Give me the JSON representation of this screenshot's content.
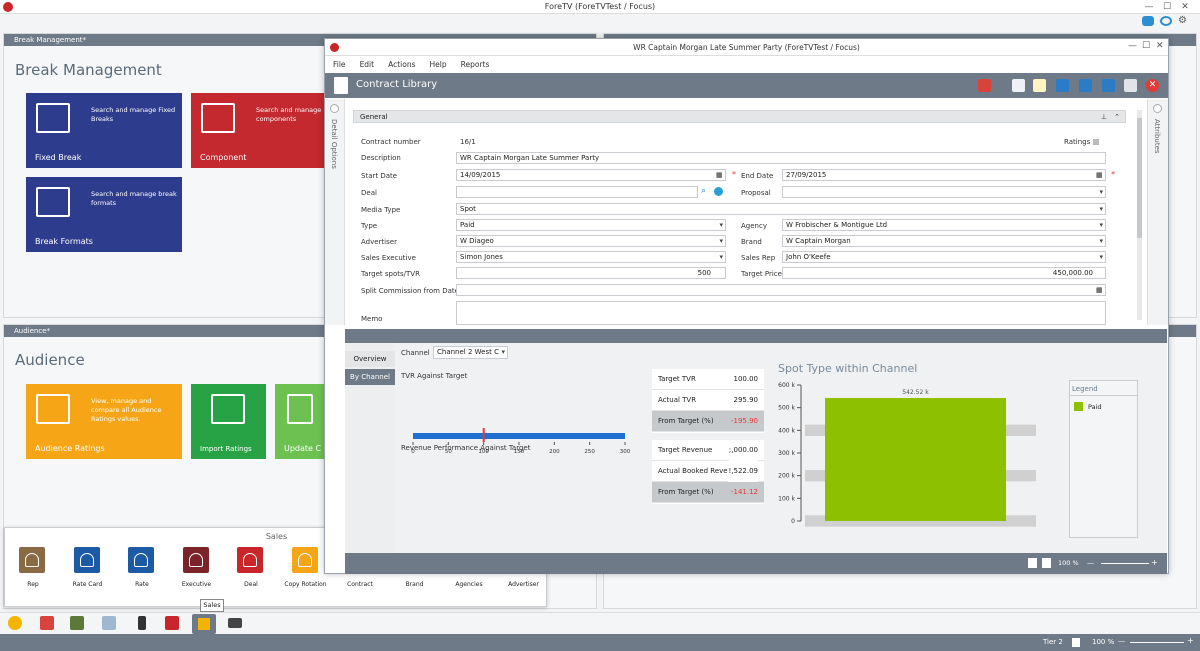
{
  "app": {
    "title": "ForeTV (ForeTVTest / Focus)"
  },
  "break_panel": {
    "header": "Break Management*",
    "title": "Break Management",
    "tiles": [
      {
        "name": "Fixed Break",
        "desc": "Search and manage Fixed Breaks",
        "color": "#2e3c8d"
      },
      {
        "name": "Component",
        "desc": "Search and manage components",
        "color": "#c3292f"
      },
      {
        "name": "Break Formats",
        "desc": "Search and manage break formats",
        "color": "#2e3c8d"
      }
    ]
  },
  "audience_panel": {
    "header": "Audience*",
    "title": "Audience",
    "tiles": [
      {
        "name": "Audience Ratings",
        "desc": "View, manage and compare all Audience Ratings values.",
        "color": "#f5a515"
      },
      {
        "name": "Import Ratings",
        "color": "#27a345"
      },
      {
        "name": "Update C",
        "color": "#6cc150"
      }
    ]
  },
  "sales_panel": {
    "title": "Sales",
    "tooltip": "Sales",
    "items": [
      {
        "label": "Rep",
        "color": "#8a6a45"
      },
      {
        "label": "Rate Card",
        "color": "#1d5aa5"
      },
      {
        "label": "Rate",
        "color": "#1d5aa5"
      },
      {
        "label": "Executive",
        "color": "#7a2328"
      },
      {
        "label": "Deal",
        "color": "#c8262b"
      },
      {
        "label": "Copy Rotation",
        "color": "#f5a515"
      },
      {
        "label": "Contract",
        "color": "#4caf50"
      },
      {
        "label": "Brand",
        "color": "#ef7d1a"
      },
      {
        "label": "Agencies",
        "color": "#5a5a5a"
      },
      {
        "label": "Advertiser",
        "color": "#5b3a8f"
      }
    ]
  },
  "contract_window": {
    "title": "WR Captain Morgan Late Summer Party (ForeTVTest / Focus)",
    "menu": [
      "File",
      "Edit",
      "Actions",
      "Help",
      "Reports"
    ],
    "header": "Contract Library",
    "left_tab": "Detail Options",
    "right_tab": "Attributes",
    "section": "General",
    "ratings_label": "Ratings",
    "form": {
      "contract_number_label": "Contract number",
      "contract_number": "16/1",
      "description_label": "Description",
      "description": "WR Captain Morgan Late Summer Party",
      "start_date_label": "Start Date",
      "start_date": "14/09/2015",
      "end_date_label": "End Date",
      "end_date": "27/09/2015",
      "deal_label": "Deal",
      "deal": "",
      "proposal_label": "Proposal",
      "proposal": "",
      "media_type_label": "Media Type",
      "media_type": "Spot",
      "type_label": "Type",
      "type": "Paid",
      "agency_label": "Agency",
      "agency": "W Frobischer & Montigue Ltd",
      "advertiser_label": "Advertiser",
      "advertiser": "W Diageo",
      "brand_label": "Brand",
      "brand": "W Captain Morgan",
      "sales_exec_label": "Sales Executive",
      "sales_exec": "Simon Jones",
      "sales_rep_label": "Sales Rep",
      "sales_rep": "John O'Keefe",
      "target_spots_label": "Target spots/TVR",
      "target_spots": "500",
      "target_price_label": "Target Price",
      "target_price": "450,000.00",
      "split_label": "Split Commission from Date",
      "split": "",
      "memo_label": "Memo"
    },
    "overview": {
      "tabs": [
        "Overview",
        "By Channel"
      ],
      "channel_label": "Channel",
      "channel": "Channel 2 West C",
      "tvr_title": "TVR Against Target",
      "tvr_ticks": [
        "0",
        "50",
        "100",
        "150",
        "200",
        "250",
        "300"
      ],
      "tvr_fill": 1.0,
      "tvr_marker": 100,
      "tvr_max": 300,
      "rev_title": "Revenue Performance Against Target",
      "rev_ticks": [
        "0",
        "100000",
        "200000",
        "300000",
        "400000",
        "500000",
        "600000"
      ],
      "rev_fill": 542520,
      "rev_marker": 225000,
      "rev_max": 600000,
      "tvr_stats": [
        {
          "label": "Target TVR",
          "value": "100.00"
        },
        {
          "label": "Actual TVR",
          "value": "295.90"
        },
        {
          "label": "From Target (%)",
          "value": "-195.90",
          "neg": true
        }
      ],
      "rev_stats": [
        {
          "label": "Target Revenue",
          "value": ";,000.00"
        },
        {
          "label": "Actual Booked Revenue",
          "value": "!,522.09"
        },
        {
          "label": "From Target (%)",
          "value": "-141.12",
          "neg": true
        }
      ],
      "chart_title": "Spot Type within Channel",
      "legend_title": "Legend"
    },
    "status": {
      "zoom": "100 %"
    }
  },
  "chart_data": {
    "type": "bar",
    "title": "Spot Type within Channel",
    "categories": [
      "Paid"
    ],
    "series": [
      {
        "name": "Paid",
        "values": [
          542.52
        ],
        "color": "#8cc000"
      }
    ],
    "data_labels": [
      "542.52 k"
    ],
    "yticks": [
      "0",
      "100 k",
      "200 k",
      "300 k",
      "400 k",
      "500 k",
      "600 k"
    ],
    "ylim": [
      0,
      600
    ],
    "legend": "right"
  },
  "taskbar": {
    "tier": "Tier 2",
    "zoom": "100 %"
  }
}
